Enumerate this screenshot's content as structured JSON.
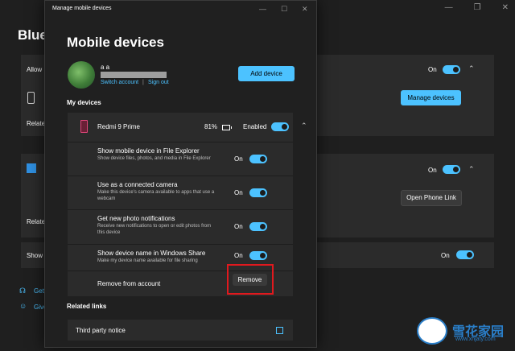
{
  "background": {
    "title": "Bluet",
    "rows": [
      {
        "label": "Allow",
        "status": "On"
      },
      {
        "label": "",
        "button": "Manage devices"
      },
      {
        "label": "Relate"
      },
      {
        "label": "",
        "status": "On"
      },
      {
        "label": "",
        "button": "Open Phone Link"
      },
      {
        "label": "Relate"
      },
      {
        "label": "Show",
        "status": "On"
      }
    ],
    "footer_links": [
      "Get",
      "Give"
    ]
  },
  "dialog": {
    "title": "Manage mobile devices",
    "heading": "Mobile devices",
    "account": {
      "name": "a a",
      "switch_label": "Switch account",
      "separator": "|",
      "signout_label": "Sign out"
    },
    "add_button": "Add device",
    "my_devices_label": "My devices",
    "device": {
      "name": "Redmi 9 Prime",
      "battery": "81%",
      "state": "Enabled"
    },
    "settings": [
      {
        "title": "Show mobile device in File Explorer",
        "desc": "Show device files, photos, and media in File Explorer",
        "state": "On"
      },
      {
        "title": "Use as a connected camera",
        "desc": "Make this device's camera available to apps that use a webcam",
        "state": "On"
      },
      {
        "title": "Get new photo notifications",
        "desc": "Receive new notifications to open or edit photos from this device",
        "state": "On"
      },
      {
        "title": "Show device name in Windows Share",
        "desc": "Make my device name available for file sharing",
        "state": "On"
      }
    ],
    "remove_label": "Remove from account",
    "remove_button": "Remove",
    "related_label": "Related links",
    "third_party": "Third party notice"
  },
  "watermark": {
    "name": "雪花家园",
    "url": "www.xhjaty.com"
  },
  "colors": {
    "accent": "#4cc2ff",
    "highlight": "#e0191e"
  }
}
